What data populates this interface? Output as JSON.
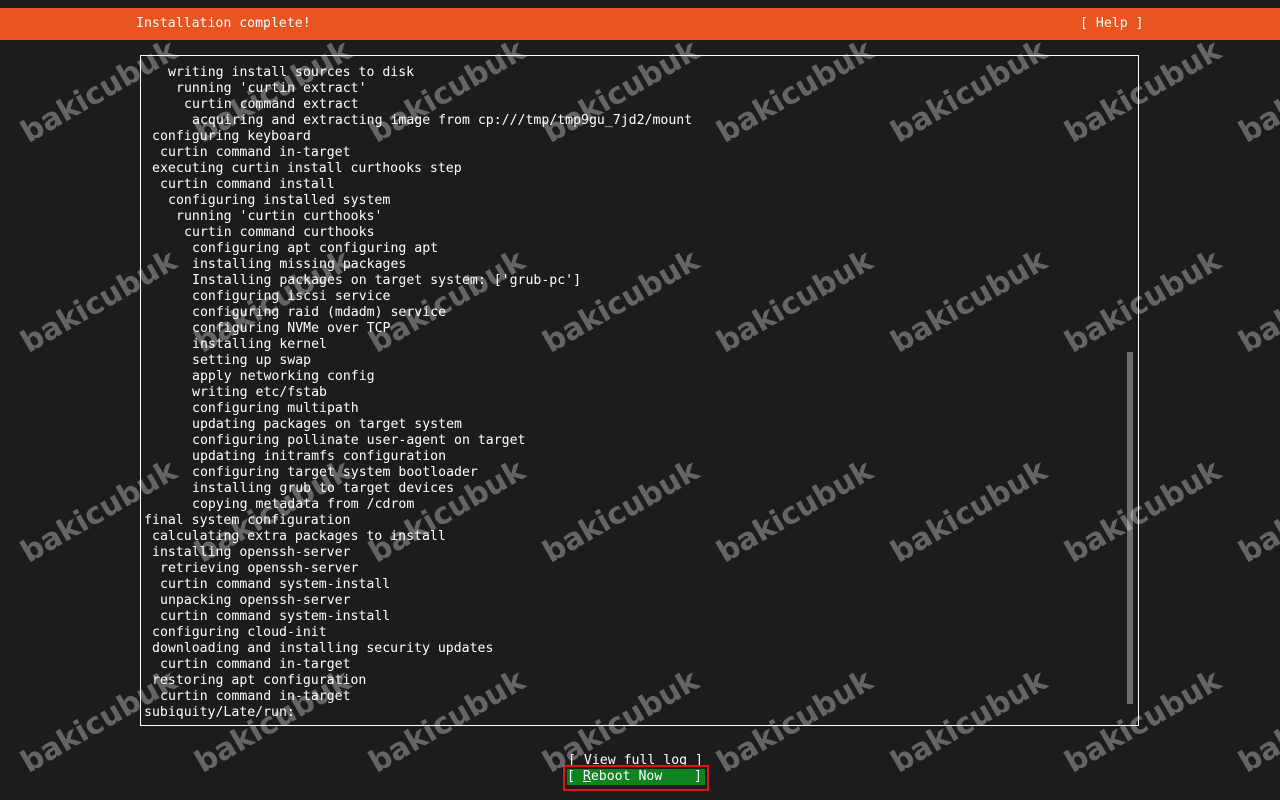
{
  "header": {
    "title": "Installation complete!",
    "help_label": "[ Help ]",
    "color": "#e95420"
  },
  "log": {
    "lines": [
      {
        "indent": 3,
        "text": "writing install sources to disk"
      },
      {
        "indent": 4,
        "text": "running 'curtin extract'"
      },
      {
        "indent": 5,
        "text": "curtin command extract"
      },
      {
        "indent": 6,
        "text": "acquiring and extracting image from cp:///tmp/tmp9gu_7jd2/mount"
      },
      {
        "indent": 1,
        "text": "configuring keyboard"
      },
      {
        "indent": 2,
        "text": "curtin command in-target"
      },
      {
        "indent": 1,
        "text": "executing curtin install curthooks step"
      },
      {
        "indent": 2,
        "text": "curtin command install"
      },
      {
        "indent": 3,
        "text": "configuring installed system"
      },
      {
        "indent": 4,
        "text": "running 'curtin curthooks'"
      },
      {
        "indent": 5,
        "text": "curtin command curthooks"
      },
      {
        "indent": 6,
        "text": "configuring apt configuring apt"
      },
      {
        "indent": 6,
        "text": "installing missing packages"
      },
      {
        "indent": 6,
        "text": "Installing packages on target system: ['grub-pc']"
      },
      {
        "indent": 6,
        "text": "configuring iscsi service"
      },
      {
        "indent": 6,
        "text": "configuring raid (mdadm) service"
      },
      {
        "indent": 6,
        "text": "configuring NVMe over TCP"
      },
      {
        "indent": 6,
        "text": "installing kernel"
      },
      {
        "indent": 6,
        "text": "setting up swap"
      },
      {
        "indent": 6,
        "text": "apply networking config"
      },
      {
        "indent": 6,
        "text": "writing etc/fstab"
      },
      {
        "indent": 6,
        "text": "configuring multipath"
      },
      {
        "indent": 6,
        "text": "updating packages on target system"
      },
      {
        "indent": 6,
        "text": "configuring pollinate user-agent on target"
      },
      {
        "indent": 6,
        "text": "updating initramfs configuration"
      },
      {
        "indent": 6,
        "text": "configuring target system bootloader"
      },
      {
        "indent": 6,
        "text": "installing grub to target devices"
      },
      {
        "indent": 6,
        "text": "copying metadata from /cdrom"
      },
      {
        "indent": 0,
        "text": "final system configuration"
      },
      {
        "indent": 1,
        "text": "calculating extra packages to install"
      },
      {
        "indent": 1,
        "text": "installing openssh-server"
      },
      {
        "indent": 2,
        "text": "retrieving openssh-server"
      },
      {
        "indent": 2,
        "text": "curtin command system-install"
      },
      {
        "indent": 2,
        "text": "unpacking openssh-server"
      },
      {
        "indent": 2,
        "text": "curtin command system-install"
      },
      {
        "indent": 1,
        "text": "configuring cloud-init"
      },
      {
        "indent": 1,
        "text": "downloading and installing security updates"
      },
      {
        "indent": 2,
        "text": "curtin command in-target"
      },
      {
        "indent": 1,
        "text": "restoring apt configuration"
      },
      {
        "indent": 2,
        "text": "curtin command in-target"
      },
      {
        "indent": 0,
        "text": "subiquity/Late/run:"
      }
    ]
  },
  "buttons": {
    "view_log_label": "[ View full log ]",
    "reboot_label_bracket_open": "[ ",
    "reboot_label_first": "R",
    "reboot_label_rest": "eboot Now    ]",
    "reboot_color": "#0e8420",
    "highlight_color": "#d71818"
  },
  "watermark": {
    "text": "bakicubuk"
  }
}
